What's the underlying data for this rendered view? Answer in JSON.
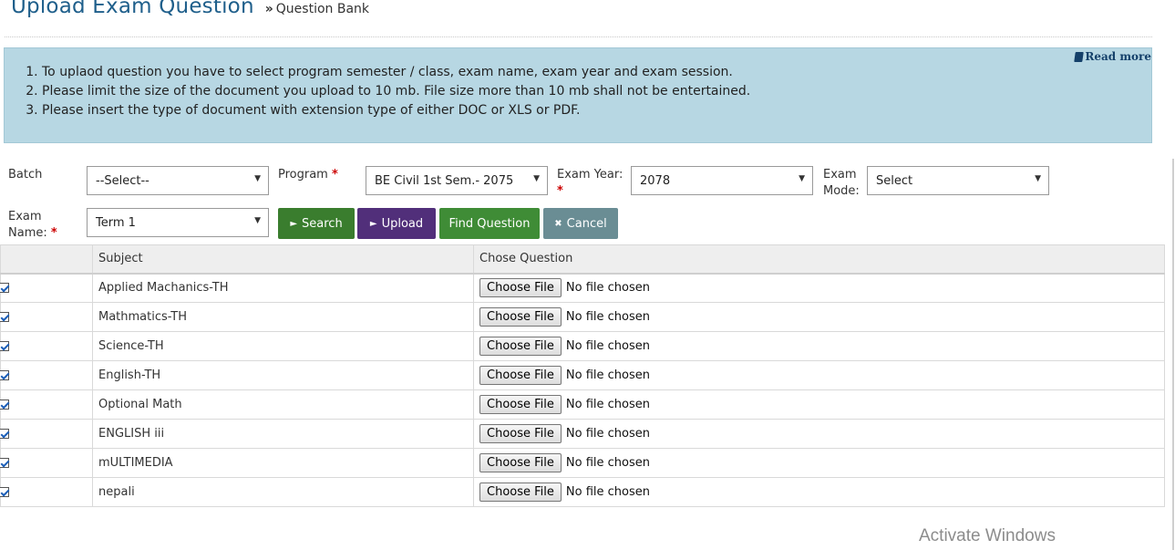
{
  "header": {
    "title": "Upload Exam Question",
    "breadcrumb": "Question Bank"
  },
  "notice": {
    "read_more": "Read more",
    "items": [
      "To uplaod question you have to select program semester / class, exam name, exam year and exam session.",
      "Please limit the size of the document you upload to 10 mb. File size more than 10 mb shall not be entertained.",
      "Please insert the type of document with extension type of either DOC or XLS or PDF."
    ]
  },
  "form": {
    "batch_label": "Batch",
    "batch_value": "--Select--",
    "program_label": "Program",
    "program_value": "BE Civil 1st Sem.- 2075",
    "exam_year_label": "Exam Year:",
    "exam_year_value": "2078",
    "exam_mode_label_1": "Exam",
    "exam_mode_label_2": "Mode:",
    "exam_mode_value": "Select",
    "exam_name_label_1": "Exam",
    "exam_name_label_2": "Name:",
    "exam_name_value": "Term 1",
    "required_mark": "*"
  },
  "buttons": {
    "search": "Search",
    "upload": "Upload",
    "find": "Find Question",
    "cancel": "Cancel"
  },
  "table": {
    "headers": [
      "",
      "Subject",
      "Chose Question"
    ],
    "choose_label": "Choose File",
    "no_file_label": "No file chosen",
    "rows": [
      {
        "subject": "Applied Machanics-TH",
        "checked": true
      },
      {
        "subject": "Mathmatics-TH",
        "checked": true
      },
      {
        "subject": "Science-TH",
        "checked": true
      },
      {
        "subject": "English-TH",
        "checked": true
      },
      {
        "subject": "Optional Math",
        "checked": true
      },
      {
        "subject": "ENGLISH iii",
        "checked": true
      },
      {
        "subject": "mULTIMEDIA",
        "checked": true
      },
      {
        "subject": "nepali",
        "checked": true
      }
    ]
  },
  "watermark": "Activate Windows",
  "colors": {
    "title": "#1f5f8b",
    "notice_bg": "#b7d7e3",
    "search_btn": "#3a7d2e",
    "upload_btn": "#512f7a",
    "find_btn": "#3f8c36",
    "cancel_btn": "#6a8d94",
    "required": "#cc0000"
  },
  "icons": {
    "read_more": "book-icon",
    "search": "play-icon",
    "upload": "play-icon",
    "cancel": "close-icon",
    "dropdown": "caret-down-icon",
    "row_check": "checkbox-icon"
  }
}
